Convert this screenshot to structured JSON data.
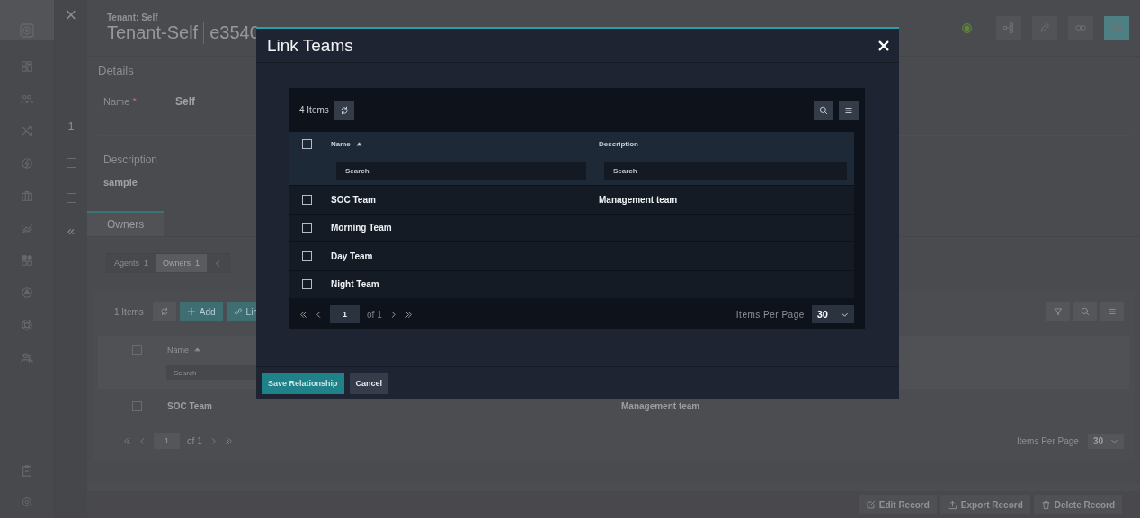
{
  "secondary_panel": {
    "close": "×",
    "count": "1",
    "collapse": "«",
    "checkboxes": [
      {
        "checked": false
      },
      {
        "checked": false
      }
    ]
  },
  "record": {
    "breadcrumb": "Tenant: Self",
    "title": "Tenant-Self",
    "id": "e3540"
  },
  "details": {
    "heading": "Details",
    "name": {
      "label": "Name",
      "required_mark": "*",
      "value": "Self"
    },
    "description": {
      "label": "Description",
      "value": "sample"
    }
  },
  "tabs": [
    {
      "label": "Owners",
      "selected": true
    }
  ],
  "subtabs": [
    {
      "label": "Agents",
      "count": "1",
      "selected": false
    },
    {
      "label": "Owners",
      "count": "1",
      "selected": true
    }
  ],
  "owners_table": {
    "count": "1 Items",
    "buttons": [
      {
        "label": "Add",
        "kind": "add"
      },
      {
        "label": "Lin",
        "kind": "link"
      }
    ],
    "select_all": {
      "checked": false
    },
    "columns": [
      {
        "label": "Name",
        "sorted_ascending": true
      }
    ],
    "search_placeholder": "Search",
    "rows": [
      {
        "checked": false,
        "name": "SOC Team",
        "description": "Management team"
      }
    ],
    "pagination": {
      "page": "1",
      "of": "of 1",
      "per_page_label": "Items Per Page",
      "per_page": "30"
    }
  },
  "record_actions": [
    {
      "label": "Edit Record",
      "kind": "edit"
    },
    {
      "label": "Export Record",
      "kind": "export"
    },
    {
      "label": "Delete Record",
      "kind": "delete"
    }
  ],
  "dialog": {
    "title": "Link Teams",
    "count": "4 Items",
    "select_all": {
      "checked": false
    },
    "columns": [
      {
        "label": "Name",
        "sorted_ascending": true,
        "placeholder": "Search"
      },
      {
        "label": "Description",
        "sorted_ascending": false,
        "placeholder": "Search"
      }
    ],
    "rows": [
      {
        "checked": false,
        "name": "SOC Team",
        "description": "Management team"
      },
      {
        "checked": false,
        "name": "Morning Team"
      },
      {
        "checked": false,
        "name": "Day Team"
      },
      {
        "checked": false,
        "name": "Night Team"
      }
    ],
    "pagination": {
      "page": "1",
      "of": "of 1",
      "per_page_label": "Items Per Page",
      "per_page": "30"
    },
    "buttons": [
      {
        "label": "Save Relationship",
        "kind": "primary"
      },
      {
        "label": "Cancel",
        "kind": "secondary"
      }
    ]
  }
}
